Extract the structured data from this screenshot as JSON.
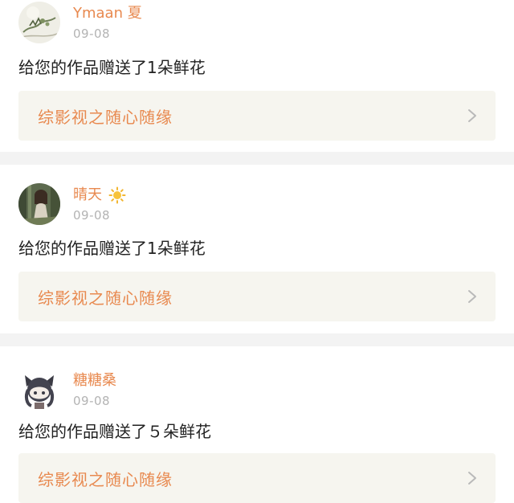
{
  "notifications": [
    {
      "username": "Ymaan 夏",
      "date": "09-08",
      "message": "给您的作品赠送了1朵鲜花",
      "work_title": "综影视之随心随缘",
      "avatar_icon": "avatar-ink-painting-icon",
      "badge_icon": ""
    },
    {
      "username": "晴天",
      "date": "09-08",
      "message": "给您的作品赠送了1朵鲜花",
      "work_title": "综影视之随心随缘",
      "avatar_icon": "avatar-girl-forest-icon",
      "badge_icon": "sun-icon"
    },
    {
      "username": "糖糖桑",
      "date": "09-08",
      "message": "给您的作品赠送了５朵鲜花",
      "work_title": "综影视之随心随缘",
      "avatar_icon": "avatar-anime-cat-girl-icon",
      "badge_icon": ""
    }
  ],
  "colors": {
    "accent": "#e8894f",
    "muted": "#b3b3b3",
    "link_background": "#f6f5ef",
    "divider": "#f3f3f3"
  }
}
